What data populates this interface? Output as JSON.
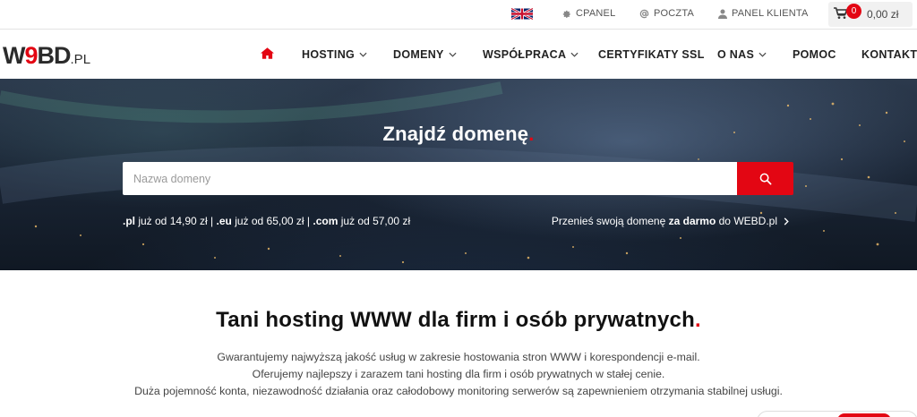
{
  "topbar": {
    "language_icon": "uk-flag-icon",
    "cpanel_label": "CPANEL",
    "poczta_label": "POCZTA",
    "panel_klienta_label": "PANEL KLIENTA",
    "cart_count": "0",
    "cart_total": "0,00 zł"
  },
  "logo": {
    "w": "W",
    "nine": "9",
    "bd": "BD",
    "pl": ".PL"
  },
  "nav": {
    "home_icon": "home-icon",
    "items": [
      {
        "label": "HOSTING",
        "dropdown": true
      },
      {
        "label": "DOMENY",
        "dropdown": true
      },
      {
        "label": "WSPÓŁPRACA",
        "dropdown": true
      },
      {
        "label": "CERTYFIKATY SSL",
        "dropdown": false
      },
      {
        "label": "O NAS",
        "dropdown": true
      },
      {
        "label": "POMOC",
        "dropdown": false
      },
      {
        "label": "KONTAKT",
        "dropdown": false
      }
    ]
  },
  "hero": {
    "title": "Znajdź domenę",
    "title_dot": ".",
    "search_placeholder": "Nazwa domeny",
    "search_value": "",
    "prices": {
      "pl_ext": ".pl",
      "pl_text": " już od 14,90 zł",
      "sep1": " | ",
      "eu_ext": ".eu",
      "eu_text": " już od 65,00 zł",
      "sep2": " | ",
      "com_ext": ".com",
      "com_text": " już od 57,00 zł"
    },
    "transfer": {
      "pre": "Przenieś swoją domenę ",
      "bold": "za darmo",
      "post": " do WEBD.pl"
    }
  },
  "content": {
    "headline": "Tani hosting WWW dla firm i osób prywatnych",
    "headline_dot": ".",
    "lines": [
      "Gwarantujemy najwyższą jakość usług w zakresie hostowania stron WWW i korespondencji e-mail.",
      "Oferujemy najlepszy i zarazem tani hosting dla firm i osób prywatnych w stałej cenie.",
      "Duża pojemność konta, niezawodność działania oraz całodobowy monitoring serwerów są zapewnieniem otrzymania stabilnej usługi."
    ]
  },
  "colors": {
    "accent": "#e30613",
    "text_dark": "#222222",
    "text_muted": "#555555",
    "hero_bg": "#1b2636"
  }
}
